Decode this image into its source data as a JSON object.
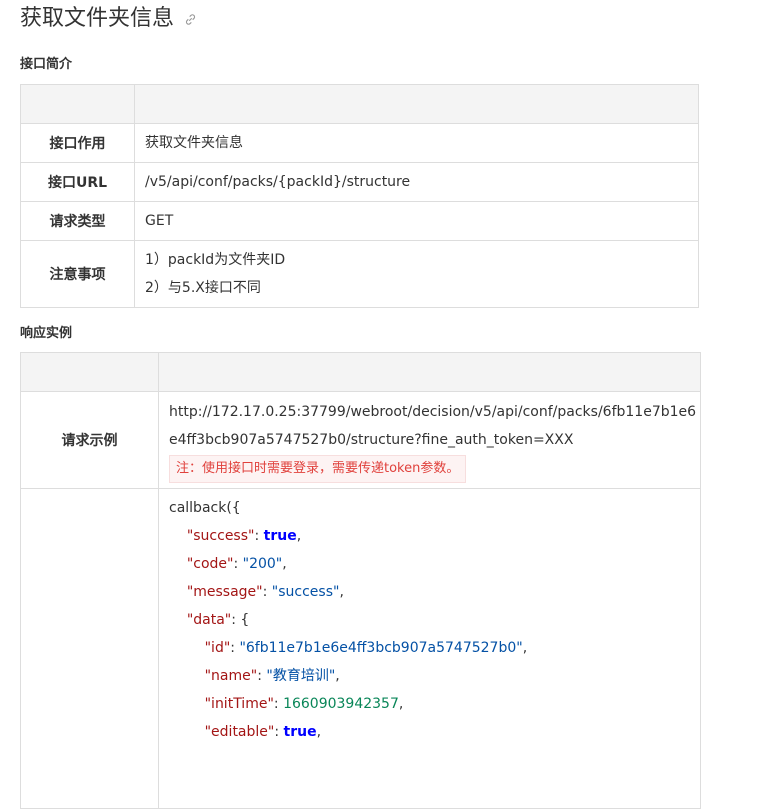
{
  "page_title": "获取文件夹信息",
  "section1": {
    "heading": "接口简介",
    "rows": {
      "purpose": {
        "label": "接口作用",
        "value": "获取文件夹信息"
      },
      "url": {
        "label": "接口URL",
        "value": "/v5/api/conf/packs/{packId}/structure"
      },
      "method": {
        "label": "请求类型",
        "value": "GET"
      },
      "notes": {
        "label": "注意事项",
        "line1": "1）packId为文件夹ID",
        "line2": "2）与5.X接口不同"
      }
    }
  },
  "section2": {
    "heading": "响应实例",
    "request": {
      "label": "请求示例",
      "url_line1": "http://172.17.0.25:37799/webroot/decision/v5/api/conf/packs/6fb11e7b1e6",
      "url_line2": "e4ff3bcb907a5747527b0/structure?fine_auth_token=XXX",
      "note": "注：使用接口时需要登录，需要传递token参数。"
    },
    "response": {
      "open": "callback({",
      "success_key": "\"success\"",
      "success_val": "true",
      "code_key": "\"code\"",
      "code_val": "\"200\"",
      "message_key": "\"message\"",
      "message_val": "\"success\"",
      "data_key": "\"data\"",
      "id_key": "\"id\"",
      "id_val": "\"6fb11e7b1e6e4ff3bcb907a5747527b0\"",
      "name_key": "\"name\"",
      "name_val": "\"教育培训\"",
      "inittime_key": "\"initTime\"",
      "inittime_val": "1660903942357",
      "editable_key": "\"editable\"",
      "editable_val": "true"
    }
  },
  "colors": {
    "key": "#a31515",
    "string": "#0451a5",
    "number": "#098658",
    "boolean": "#0000ff",
    "note": "#e0413c"
  }
}
